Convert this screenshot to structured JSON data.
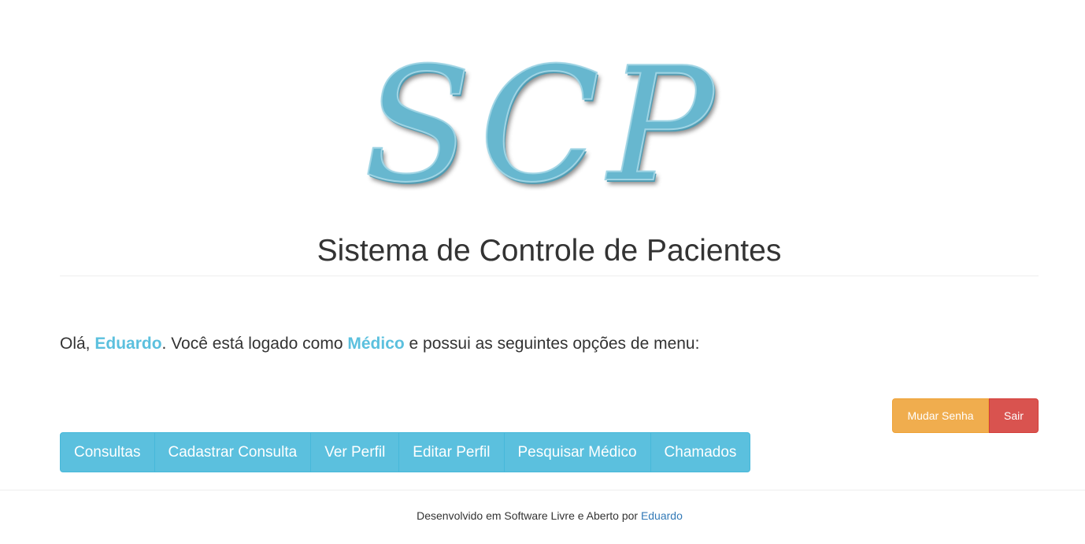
{
  "logo": {
    "text": "SCP",
    "color": "#67b7cf"
  },
  "header": {
    "title": "Sistema de Controle de Pacientes"
  },
  "greeting": {
    "prefix": "Olá, ",
    "user_name": "Eduardo",
    "middle": ". Você está logado como ",
    "role": "Médico",
    "suffix": " e possui as seguintes opções de menu:",
    "highlight_color": "#5bc0de"
  },
  "account_actions": {
    "change_password_label": "Mudar Senha",
    "logout_label": "Sair"
  },
  "menu": {
    "items": [
      {
        "label": "Consultas"
      },
      {
        "label": "Cadastrar Consulta"
      },
      {
        "label": "Ver Perfil"
      },
      {
        "label": "Editar Perfil"
      },
      {
        "label": "Pesquisar Médico"
      },
      {
        "label": "Chamados"
      }
    ],
    "color": "#5bc0de"
  },
  "footer": {
    "text": "Desenvolvido em Software Livre e Aberto por ",
    "author_link": "Eduardo"
  }
}
